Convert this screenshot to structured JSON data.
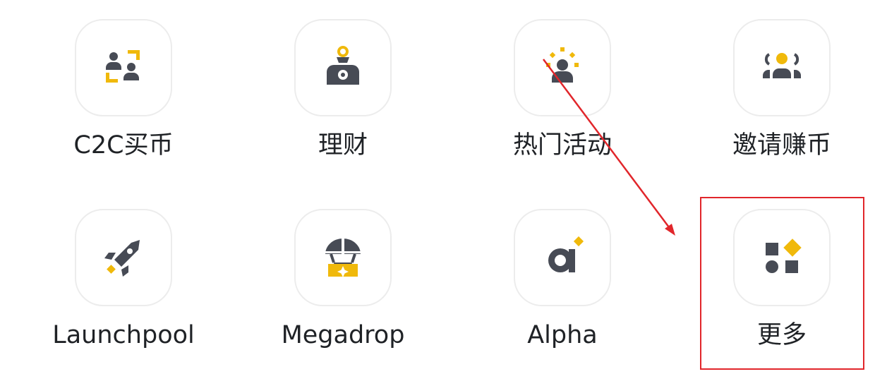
{
  "colors": {
    "icon_dark": "#474b55",
    "icon_yellow": "#f0b90b",
    "label_text": "#1f2226",
    "tile_border": "#ececec",
    "annotation_red": "#e1262b"
  },
  "grid": {
    "items": [
      {
        "label": "C2C买币",
        "icon": "c2c-exchange-icon"
      },
      {
        "label": "理财",
        "icon": "money-bag-icon"
      },
      {
        "label": "热门活动",
        "icon": "hot-event-icon"
      },
      {
        "label": "邀请赚币",
        "icon": "invite-friends-icon"
      },
      {
        "label": "Launchpool",
        "icon": "rocket-icon"
      },
      {
        "label": "Megadrop",
        "icon": "parachute-box-icon"
      },
      {
        "label": "Alpha",
        "icon": "alpha-icon"
      },
      {
        "label": "更多",
        "icon": "more-shapes-icon"
      }
    ]
  },
  "annotation": {
    "highlighted_item": "更多",
    "type": "red-arrow-and-box"
  }
}
